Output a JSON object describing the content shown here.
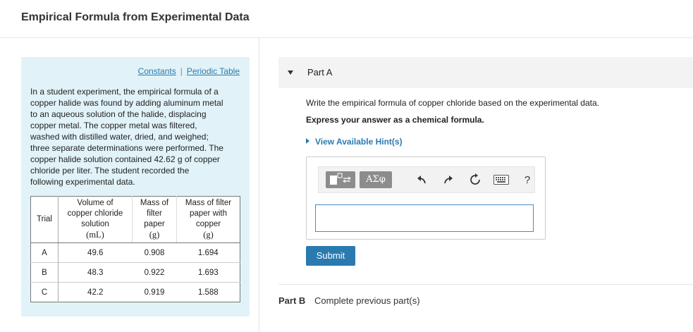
{
  "page": {
    "title": "Empirical Formula from Experimental Data"
  },
  "info_panel": {
    "links": [
      {
        "label": "Constants"
      },
      {
        "label": "Periodic Table"
      }
    ],
    "separator": "|",
    "intro_lines": [
      "In a student experiment, the empirical formula of a",
      "copper halide was found by adding aluminum metal",
      "to an aqueous solution of the halide, displacing",
      "copper metal. The copper metal was filtered,",
      "washed with distilled water, dried, and weighed;",
      "three separate determinations were performed. The",
      "copper halide solution contained 42.62 g of copper",
      "chloride per liter. The student recorded the",
      "following experimental data."
    ],
    "table": {
      "headers": {
        "trial": "Trial",
        "volume": [
          "Volume of",
          "copper chloride",
          "solution"
        ],
        "volume_unit": "(mL)",
        "filter": [
          "Mass of",
          "filter",
          "paper"
        ],
        "filter_unit": "(g)",
        "filter_copper": [
          "Mass of filter",
          "paper with",
          "copper"
        ],
        "filter_copper_unit": "(g)"
      },
      "rows": [
        {
          "trial": "A",
          "volume": "49.6",
          "filter": "0.908",
          "filter_copper": "1.694"
        },
        {
          "trial": "B",
          "volume": "48.3",
          "filter": "0.922",
          "filter_copper": "1.693"
        },
        {
          "trial": "C",
          "volume": "42.2",
          "filter": "0.919",
          "filter_copper": "1.588"
        }
      ]
    }
  },
  "part_a": {
    "label": "Part A",
    "prompt": "Write the empirical formula of copper chloride based on the experimental data.",
    "instruction": "Express your answer as a chemical formula.",
    "hint_link": "View Available Hint(s)",
    "toolbar": {
      "greek_label": "ΑΣφ",
      "help_label": "?",
      "icons": [
        "templates-icon",
        "greek-symbols-icon",
        "undo-icon",
        "redo-icon",
        "reset-icon",
        "keyboard-icon",
        "help-icon"
      ]
    },
    "answer_value": "",
    "submit_label": "Submit"
  },
  "part_b": {
    "label": "Part B",
    "status": "Complete previous part(s)"
  },
  "colors": {
    "link": "#2a7ab0",
    "submit": "#2a7ab0",
    "panel_bg": "#e1f3f8",
    "input_border": "#4a8bc2"
  }
}
